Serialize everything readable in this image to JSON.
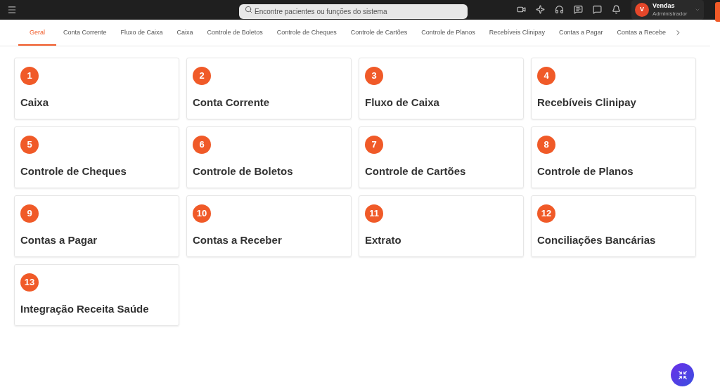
{
  "topbar": {
    "search": {
      "placeholder": "Encontre pacientes ou funções do sistema"
    },
    "user": {
      "initial": "V",
      "name": "Vendas",
      "role": "Administrador"
    }
  },
  "tabs": [
    {
      "label": "Geral",
      "selected": true
    },
    {
      "label": "Conta Corrente",
      "selected": false
    },
    {
      "label": "Fluxo de Caixa",
      "selected": false
    },
    {
      "label": "Caixa",
      "selected": false
    },
    {
      "label": "Controle de Boletos",
      "selected": false
    },
    {
      "label": "Controle de Cheques",
      "selected": false
    },
    {
      "label": "Controle de Cartões",
      "selected": false
    },
    {
      "label": "Controle de Planos",
      "selected": false
    },
    {
      "label": "Recebíveis Clinipay",
      "selected": false
    },
    {
      "label": "Contas a Pagar",
      "selected": false
    },
    {
      "label": "Contas a Recebe",
      "selected": false
    }
  ],
  "cards": [
    {
      "number": "1",
      "title": "Caixa"
    },
    {
      "number": "2",
      "title": "Conta Corrente"
    },
    {
      "number": "3",
      "title": "Fluxo de Caixa"
    },
    {
      "number": "4",
      "title": "Recebíveis Clinipay"
    },
    {
      "number": "5",
      "title": "Controle de Cheques"
    },
    {
      "number": "6",
      "title": "Controle de Boletos"
    },
    {
      "number": "7",
      "title": "Controle de Cartões"
    },
    {
      "number": "8",
      "title": "Controle de Planos"
    },
    {
      "number": "9",
      "title": "Contas a Pagar"
    },
    {
      "number": "10",
      "title": "Contas a Receber"
    },
    {
      "number": "11",
      "title": "Extrato"
    },
    {
      "number": "12",
      "title": "Conciliações Bancárias"
    },
    {
      "number": "13",
      "title": "Integração Receita Saúde"
    }
  ]
}
